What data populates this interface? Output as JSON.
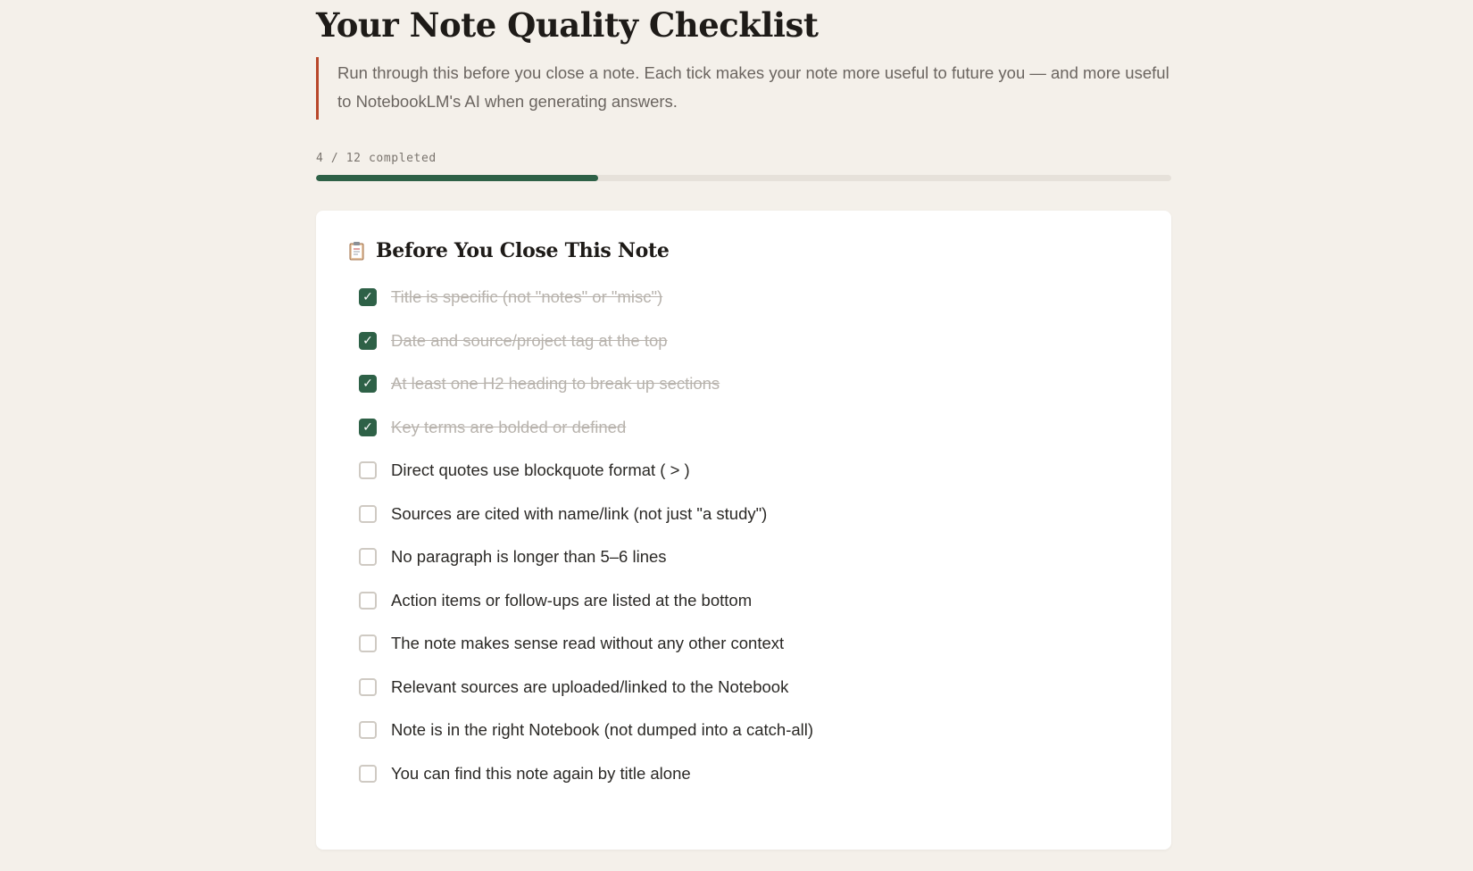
{
  "title": "Your Note Quality Checklist",
  "intro": "Run through this before you close a note. Each tick makes your note more useful to future you — and more useful to NotebookLM's AI when generating answers.",
  "progress": {
    "completed": 4,
    "total": 12,
    "label": "4 / 12 completed",
    "fill_fraction": 0.33
  },
  "colors": {
    "accent": "#2e6147",
    "quote_border": "#b8472a",
    "background": "#f4f0ea"
  },
  "card": {
    "icon": "clipboard-icon",
    "title": "Before You Close This Note",
    "items": [
      {
        "label": "Title is specific (not \"notes\" or \"misc\")",
        "checked": true
      },
      {
        "label": "Date and source/project tag at the top",
        "checked": true
      },
      {
        "label": "At least one H2 heading to break up sections",
        "checked": true
      },
      {
        "label": "Key terms are bolded or defined",
        "checked": true
      },
      {
        "label": "Direct quotes use blockquote format ( > )",
        "checked": false
      },
      {
        "label": "Sources are cited with name/link (not just \"a study\")",
        "checked": false
      },
      {
        "label": "No paragraph is longer than 5–6 lines",
        "checked": false
      },
      {
        "label": "Action items or follow-ups are listed at the bottom",
        "checked": false
      },
      {
        "label": "The note makes sense read without any other context",
        "checked": false
      },
      {
        "label": "Relevant sources are uploaded/linked to the Notebook",
        "checked": false
      },
      {
        "label": "Note is in the right Notebook (not dumped into a catch-all)",
        "checked": false
      },
      {
        "label": "You can find this note again by title alone",
        "checked": false
      }
    ]
  }
}
